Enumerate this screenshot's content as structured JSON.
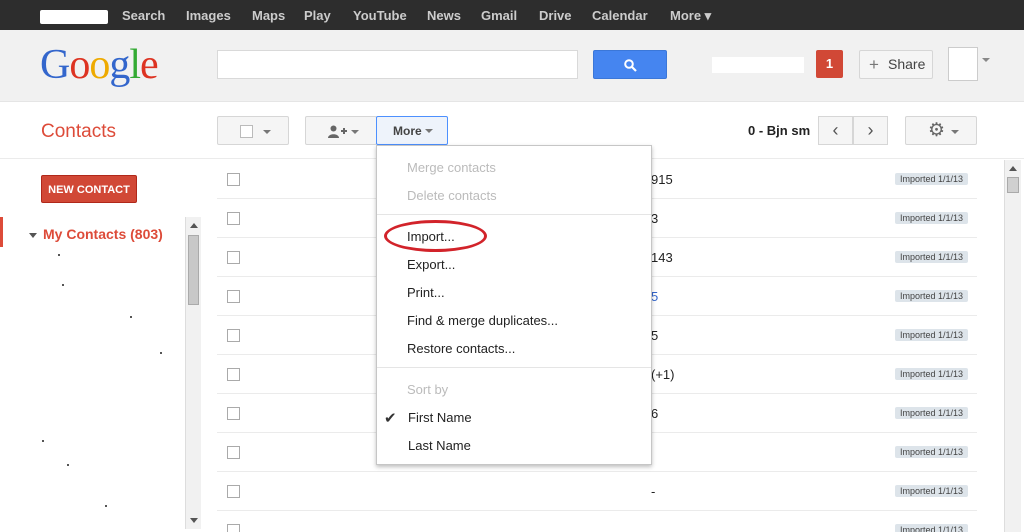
{
  "topnav": {
    "items": [
      "Search",
      "Images",
      "Maps",
      "Play",
      "YouTube",
      "News",
      "Gmail",
      "Drive",
      "Calendar",
      "More ▾"
    ]
  },
  "header": {
    "logo_letters": [
      "G",
      "o",
      "o",
      "g",
      "l",
      "e"
    ],
    "search_value": "",
    "notifications_count": "1",
    "share_label": "Share"
  },
  "toolbar": {
    "title": "Contacts",
    "more_label": "More",
    "page_range": "0 - Bjn sm",
    "prev_glyph": "‹",
    "next_glyph": "›"
  },
  "sidebar": {
    "new_contact_label": "NEW CONTACT",
    "my_contacts_label": "My Contacts (803)"
  },
  "contacts": {
    "rows": [
      {
        "name": "915",
        "badge": "Imported 1/1/13",
        "link": false
      },
      {
        "name": "3",
        "badge": "Imported 1/1/13",
        "link": false
      },
      {
        "name": "143",
        "badge": "Imported 1/1/13",
        "link": false
      },
      {
        "name": "5",
        "badge": "Imported 1/1/13",
        "link": true
      },
      {
        "name": "5",
        "badge": "Imported 1/1/13",
        "link": false
      },
      {
        "name": "(+1)",
        "badge": "Imported 1/1/13",
        "link": false
      },
      {
        "name": "6",
        "badge": "Imported 1/1/13",
        "link": false
      },
      {
        "name": "",
        "badge": "Imported 1/1/13",
        "link": false
      },
      {
        "name": "-",
        "badge": "Imported 1/1/13",
        "link": false
      },
      {
        "name": "",
        "badge": "Imported 1/1/13",
        "link": false
      }
    ]
  },
  "more_menu": {
    "merge": "Merge contacts",
    "delete": "Delete contacts",
    "import": "Import...",
    "export": "Export...",
    "print": "Print...",
    "find_merge": "Find & merge duplicates...",
    "restore": "Restore contacts...",
    "sort_by": "Sort by",
    "first_name": "First Name",
    "last_name": "Last Name"
  },
  "colors": {
    "brand_red": "#dd4b39",
    "search_blue": "#4585f0",
    "annotation_circle": "#d2232a"
  }
}
